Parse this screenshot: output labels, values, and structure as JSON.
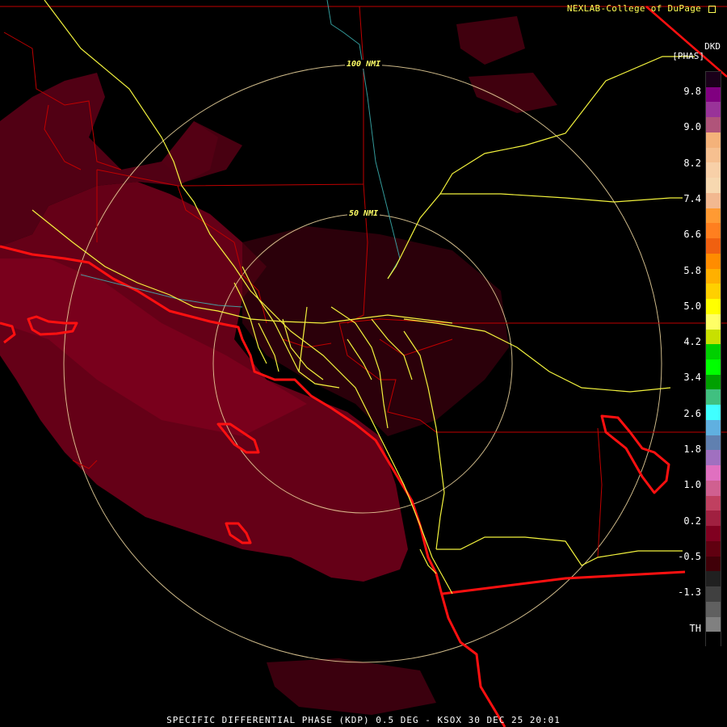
{
  "credit": "NEXLAB-College of DuPage",
  "product_title": "SPECIFIC DIFFERENTIAL PHASE (KDP) 0.5 DEG - KSOX 30 DEC 25 20:01",
  "range_rings": [
    {
      "label": "50 NMI"
    },
    {
      "label": "100 NMI"
    }
  ],
  "legend": {
    "title": "DKD",
    "unit": "[PHAS]",
    "ticks": [
      "9.8",
      "9.0",
      "8.2",
      "7.4",
      "6.6",
      "5.8",
      "5.0",
      "4.2",
      "3.4",
      "2.6",
      "1.8",
      "1.0",
      "0.2",
      "-0.5",
      "-1.3",
      "TH"
    ],
    "bins": [
      "#1a001a",
      "#800080",
      "#993399",
      "#b0547a",
      "#f4b27a",
      "#f6c090",
      "#f8d0a8",
      "#f7d8b0",
      "#f2b890",
      "#ff9a33",
      "#ff7f1f",
      "#f06010",
      "#ff8c00",
      "#ffb000",
      "#ffd000",
      "#ffff00",
      "#ffff66",
      "#c8e000",
      "#00d000",
      "#00ff00",
      "#00a000",
      "#40c080",
      "#40ffff",
      "#60b0e0",
      "#6080b0",
      "#a070c0",
      "#e070c0",
      "#d06090",
      "#c04060",
      "#a02040",
      "#800020",
      "#600010",
      "#400008",
      "#202020",
      "#404040",
      "#606060",
      "#808080",
      "#000000"
    ]
  },
  "map_colors": {
    "boundary": "#c00000",
    "coast": "#ff1010",
    "highway": "#ffff40",
    "ring": "#f0d8a0",
    "echo": "#6a0018",
    "echo_dark": "#4a0012",
    "river": "#40c0c0"
  }
}
